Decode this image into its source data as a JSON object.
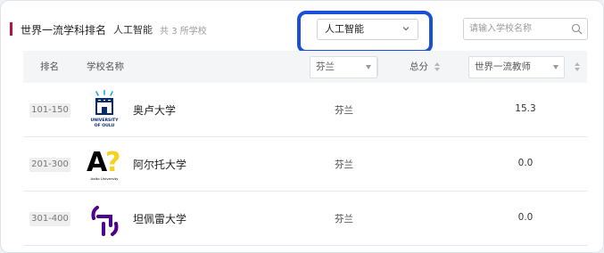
{
  "header": {
    "title": "世界一流学科排名",
    "subject": "人工智能",
    "count_text": "共 3 所学校"
  },
  "subject_select": {
    "value": "人工智能"
  },
  "search": {
    "placeholder": "请输入学校名称"
  },
  "table": {
    "columns": {
      "rank": "排名",
      "school": "学校名称",
      "country_filter": "芬兰",
      "total": "总分",
      "indicator": "世界一流教师"
    },
    "rows": [
      {
        "rank": "101-150",
        "name": "奥卢大学",
        "country": "芬兰",
        "score": "15.3",
        "logo": "university-of-oulu-logo",
        "logo_text": [
          "UNIVERSITY",
          "OF OULU"
        ]
      },
      {
        "rank": "201-300",
        "name": "阿尔托大学",
        "country": "芬兰",
        "score": "0.0",
        "logo": "aalto-university-logo",
        "logo_text": [
          "A?",
          "Aalto University"
        ]
      },
      {
        "rank": "301-400",
        "name": "坦佩雷大学",
        "country": "芬兰",
        "score": "0.0",
        "logo": "tampere-university-logo",
        "logo_text": []
      }
    ]
  },
  "colors": {
    "accent": "#b4153a",
    "highlight": "#1a4fd8",
    "aalto_yellow": "#f3d222",
    "tampere_purple": "#4e008e"
  }
}
